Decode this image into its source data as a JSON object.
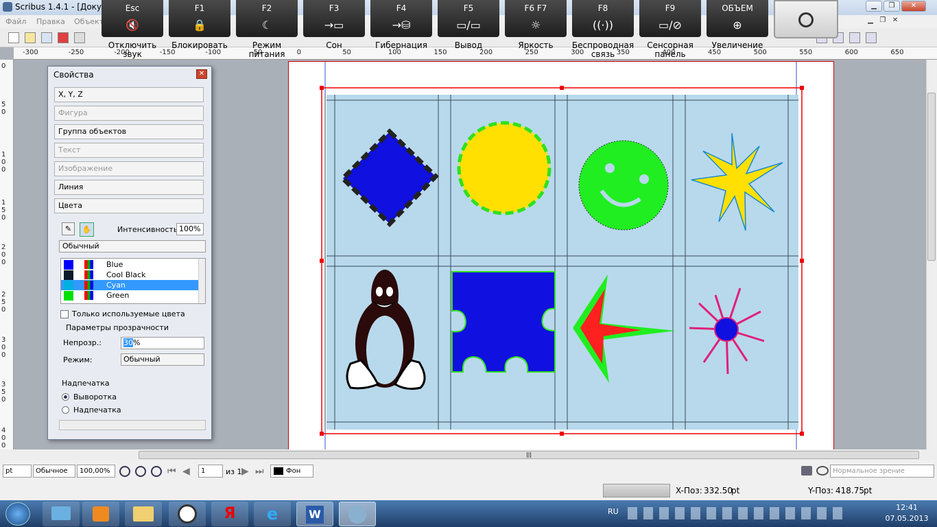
{
  "window": {
    "title": "Scribus 1.4.1 - [Документ-1]"
  },
  "menu": [
    "Файл",
    "Правка",
    "Объект"
  ],
  "osd": {
    "keys": [
      {
        "key": "Esc",
        "label": "Отключить звук",
        "glyph": "🔇"
      },
      {
        "key": "F1",
        "label": "Блокировать",
        "glyph": "🔒"
      },
      {
        "key": "F2",
        "label": "Режим питания",
        "glyph": "☾"
      },
      {
        "key": "F3",
        "label": "Сон",
        "glyph": "→▭"
      },
      {
        "key": "F4",
        "label": "Гибернация",
        "glyph": "→⛁"
      },
      {
        "key": "F5",
        "label": "Вывод",
        "glyph": "▭/▭"
      },
      {
        "key": "F6   F7",
        "label": "Яркость",
        "glyph": "☼"
      },
      {
        "key": "F8",
        "label": "Беспроводная связь",
        "glyph": "((·))"
      },
      {
        "key": "F9",
        "label": "Сенсорная панель",
        "glyph": "▭/⊘"
      },
      {
        "key": "ОБЪЕМ",
        "label": "Увеличение",
        "glyph": "⊕"
      }
    ]
  },
  "ruler_h": [
    "-300",
    "-250",
    "-200",
    "-150",
    "-100",
    "-50",
    "0",
    "50",
    "100",
    "150",
    "200",
    "250",
    "300",
    "350",
    "400",
    "450",
    "500",
    "550",
    "600",
    "650"
  ],
  "properties": {
    "title": "Свойства",
    "sections": [
      {
        "label": "X, Y, Z",
        "enabled": true
      },
      {
        "label": "Фигура",
        "enabled": false
      },
      {
        "label": "Группа объектов",
        "enabled": true
      },
      {
        "label": "Текст",
        "enabled": false
      },
      {
        "label": "Изображение",
        "enabled": false
      },
      {
        "label": "Линия",
        "enabled": true
      },
      {
        "label": "Цвета",
        "enabled": true
      }
    ],
    "intensity_label": "Интенсивность:",
    "intensity_value": "100%",
    "blend_mode": "Обычный",
    "colors": [
      {
        "name": "Blue",
        "hex": "#0000ff"
      },
      {
        "name": "Cool Black",
        "hex": "#0a1a2a"
      },
      {
        "name": "Cyan",
        "hex": "#00b0e0"
      },
      {
        "name": "Green",
        "hex": "#00e000"
      }
    ],
    "selected_color": "Cyan",
    "only_used_label": "Только используемые цвета",
    "transparency_group": "Параметры прозрачности",
    "opacity_label": "Непрозр.:",
    "opacity_value": "30",
    "opacity_unit": "%",
    "mode_label": "Режим:",
    "mode_value": "Обычный",
    "overprint_group": "Надпечатка",
    "overprint_options": [
      "Выворотка",
      "Надпечатка"
    ],
    "overprint_selected": "Выворотка"
  },
  "statusbar": {
    "unit": "pt",
    "view_mode": "Обычное",
    "zoom": "100,00%",
    "page": "1",
    "of_pages": "из 1",
    "layer": "Фон",
    "vision": "Нормальное зрение"
  },
  "coords": {
    "x_label": "X-Поз:",
    "x_value": "332.50",
    "x_unit": "pt",
    "y_label": "Y-Поз:",
    "y_value": "418.75",
    "y_unit": "pt"
  },
  "taskbar": {
    "lang": "RU",
    "time": "12:41",
    "date": "07.05.2013"
  },
  "colors": {
    "grid_bg": "#b8d9ec",
    "accent": "#3399ff"
  }
}
